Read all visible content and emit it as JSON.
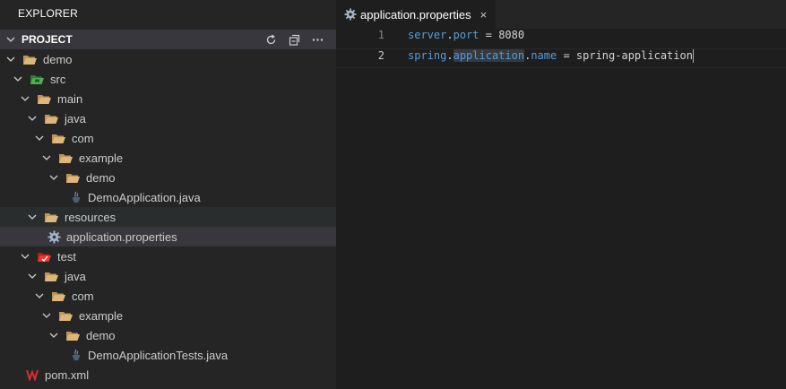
{
  "explorer": {
    "title": "EXPLORER",
    "section_title": "PROJECT"
  },
  "tree": [
    {
      "label": "demo",
      "icon": "folder-open-icon"
    },
    {
      "label": "src",
      "icon": "folder-src-icon"
    },
    {
      "label": "main",
      "icon": "folder-open-icon"
    },
    {
      "label": "java",
      "icon": "folder-open-icon"
    },
    {
      "label": "com",
      "icon": "folder-open-icon"
    },
    {
      "label": "example",
      "icon": "folder-open-icon"
    },
    {
      "label": "demo",
      "icon": "folder-open-icon"
    },
    {
      "label": "DemoApplication.java",
      "icon": "java-file-icon"
    },
    {
      "label": "resources",
      "icon": "folder-open-icon"
    },
    {
      "label": "application.properties",
      "icon": "gear-file-icon"
    },
    {
      "label": "test",
      "icon": "folder-test-icon"
    },
    {
      "label": "java",
      "icon": "folder-open-icon"
    },
    {
      "label": "com",
      "icon": "folder-open-icon"
    },
    {
      "label": "example",
      "icon": "folder-open-icon"
    },
    {
      "label": "demo",
      "icon": "folder-open-icon"
    },
    {
      "label": "DemoApplicationTests.java",
      "icon": "java-file-icon"
    },
    {
      "label": "pom.xml",
      "icon": "maven-file-icon"
    }
  ],
  "editor": {
    "tab_label": "application.properties",
    "tab_close": "×",
    "lines": [
      {
        "number": "1",
        "key_a": "server",
        "key_b": "port",
        "value": "8080"
      },
      {
        "number": "2",
        "key_a": "spring",
        "key_b": "application",
        "key_c": "name",
        "value": "spring-application"
      }
    ]
  },
  "colors": {
    "sidebar_bg": "#252526",
    "editor_bg": "#1e1e1e",
    "folder": "#dcb67a",
    "key_blue": "#569cd6"
  }
}
